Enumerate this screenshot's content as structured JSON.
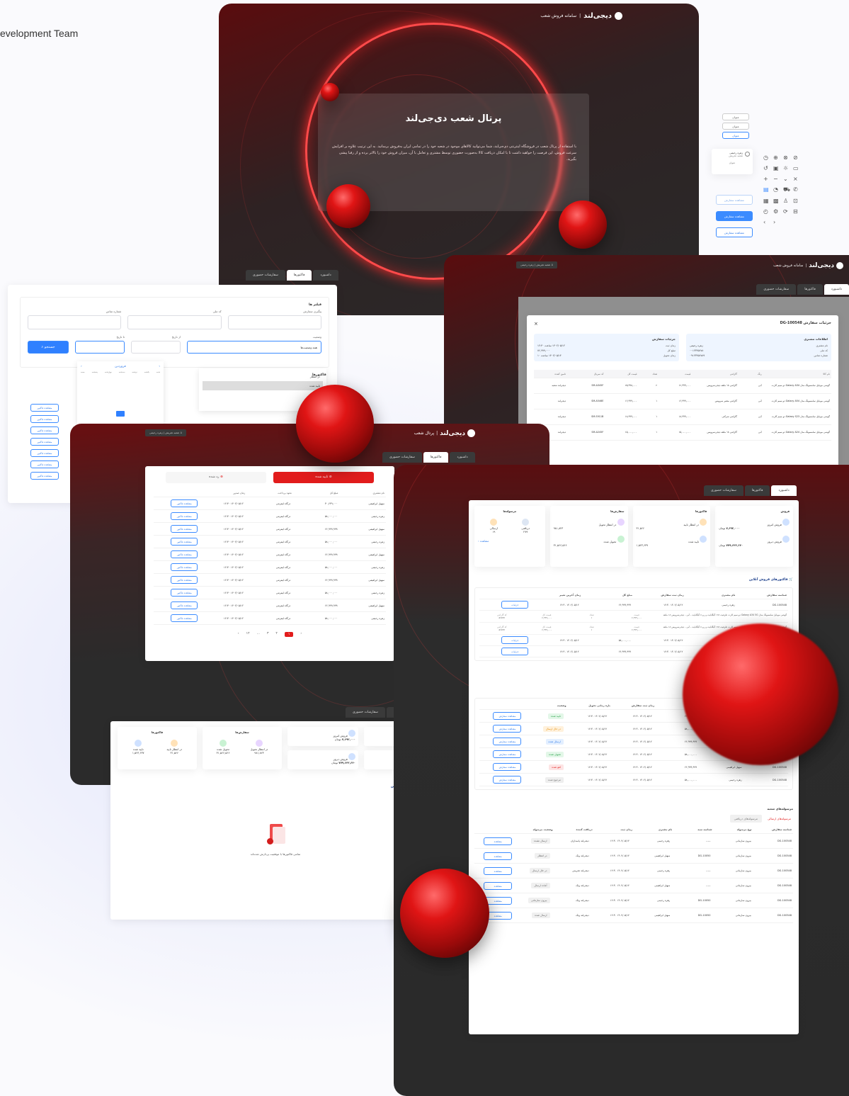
{
  "team_label": "evelopment Team",
  "brand": {
    "logo": "دیجی‌لند",
    "separator": "|",
    "app_name": "سامانه فروش شعب",
    "portal_short": "پرتال شعب"
  },
  "hero": {
    "title": "پرتال شعب دی‌جی‌لند",
    "body": "با استفاده از پرتال شعب در فروشگاه اینترنتی دی‌جی‌لند، شما می‌توانید کالاهای موجود در شعبه خود را در تمامی ایران به‌فروش برسانید. به این ترتیب علاوه بر افزایش سرعت فروش، این فرصت را خواهید داشت تا با امکان دریافت کالا به‌صورت حضوری توسط مشتری و تعامل با آن، میزان فروش خود را بالاتر برده و از رقبا پیشی بگیرید."
  },
  "tabs": {
    "dashboard": "داشبورد",
    "invoices": "فاکتورها",
    "in_person": "سفارشات حضوری"
  },
  "user_chip": "شعبه تجریش | زهره رحیمی",
  "side_panel": {
    "type_buttons": [
      "عنوان",
      "عنوان",
      "عنوان"
    ],
    "profile_name": "زهره رحیمی",
    "profile_sub": "شعبه تجریش",
    "profile_extra": "عنوان",
    "view_order": "مشاهده سفارش"
  },
  "filters": {
    "section": "فیلتر ها",
    "tracking": "پیگیری سفارش",
    "customer": "نام مشتری",
    "code": "کد ملی",
    "phone": "شماره تماس",
    "from": "از تاریخ",
    "to": "تا تاریخ",
    "status": "وضعیت",
    "status_value": "همه وضعیت‌ها",
    "search": "جستجو",
    "status_options": [
      "در انتظار",
      "تایید شده",
      "لغو شده"
    ],
    "calendar_month": "فروردین",
    "weekdays": [
      "شنبه",
      "یکشنبه",
      "دوشنبه",
      "سه‌شنبه",
      "چهارشنبه",
      "پنجشنبه",
      "جمعه"
    ],
    "invoices_label": "فاکتورها"
  },
  "order_modal": {
    "title": "جزئیات سفارش DG-100548",
    "close": "×",
    "customer_title": "اطلاعات مشتری",
    "customer_rows": [
      {
        "k": "نام مشتری",
        "v": "زهره رحیمی"
      },
      {
        "k": "کد ملی",
        "v": "۰۰۱۲۳۴۵۶۷۸"
      },
      {
        "k": "شماره تماس",
        "v": "۰۹۱۲۳۴۵۶۷۸۹"
      }
    ],
    "order_title": "جزئیات سفارش",
    "order_rows": [
      {
        "k": "زمان ثبت",
        "v": "۱۴۰۲/۰۵/۱۲ ساعت ۱۲:۳۰"
      },
      {
        "k": "مبلغ کل",
        "v": "۷۶,۹۹۹,۰۰۰"
      },
      {
        "k": "زمان تحویل",
        "v": "۱۴۰۲/۰۵/۱۴ ساعت ۱۰"
      }
    ],
    "columns": [
      "نام کالا",
      "رنگ",
      "گارانتی",
      "قیمت",
      "تعداد",
      "قیمت کل",
      "کد سریال",
      "تامین کننده"
    ],
    "items": [
      {
        "name": "گوشی موبایل سامسونگ مدل Galaxy A34 دو سیم کارت",
        "color": "آبی",
        "warranty": "گارانتی ۱۸ ماهه دیجی‌سرویس",
        "price": "۱۲,۹۹۹,۰۰۰",
        "qty": "۲",
        "total": "۲۵,۹۹۸,۰۰۰",
        "serial": "SM-A345F",
        "vendor": "دیجی‌لند شعبه"
      },
      {
        "name": "گوشی موبایل سامسونگ مدل Galaxy A54 دو سیم کارت",
        "color": "آبی",
        "warranty": "گارانتی معتبر سرویس",
        "price": "۱۶,۹۹۹,۰۰۰",
        "qty": "۱",
        "total": "۱۶,۹۹۹,۰۰۰",
        "serial": "SM-A546E",
        "vendor": "دیجی‌لند"
      },
      {
        "name": "گوشی موبایل سامسونگ مدل Galaxy S23 دو سیم کارت",
        "color": "آبی",
        "warranty": "گارانتی شرکتی",
        "price": "۱۸,۹۹۹,۰۰۰",
        "qty": "۱",
        "total": "۱۸,۹۹۹,۰۰۰",
        "serial": "SM-S911B",
        "vendor": "دیجی‌لند"
      },
      {
        "name": "گوشی موبایل سامسونگ مدل Galaxy A24 دو سیم کارت",
        "color": "آبی",
        "warranty": "گارانتی ۱۸ ماهه دیجی‌سرویس",
        "price": "۱۵,۰۰۰,۰۰۰",
        "qty": "۱",
        "total": "۱۵,۰۰۰,۰۰۰",
        "serial": "SM-A245F",
        "vendor": "دیجی‌لند"
      }
    ]
  },
  "invoice_list": {
    "tab_confirmed": "تایید شده",
    "tab_rejected": "رد شده",
    "columns": [
      "نام مشتری",
      "مبلغ کل",
      "نحوه پرداخت",
      "زمان صدور"
    ],
    "payment": "درگاه اینترنتی",
    "date": "۱۴۰۲/۰۵/۱۲ ۱۲:۳۰",
    "action": "مشاهده فاکتور",
    "rows": [
      {
        "customer": "سهیل ابراهیمی",
        "amount": "۳۰,۶۳۹,۰۰۰"
      },
      {
        "customer": "زهره رحیمی",
        "amount": "۵۸,۰۰۰,۰۰۰"
      },
      {
        "customer": "سهیل ابراهیمی",
        "amount": "۶۶,۹۹۹,۹۹۹"
      },
      {
        "customer": "زهره رحیمی",
        "amount": "۵۸,۰۰۰,۰۰۰"
      },
      {
        "customer": "سهیل ابراهیمی",
        "amount": "۶۶,۹۹۹,۹۹۹"
      },
      {
        "customer": "زهره رحیمی",
        "amount": "۵۸,۰۰۰,۰۰۰"
      },
      {
        "customer": "سهیل ابراهیمی",
        "amount": "۶۶,۹۹۹,۹۹۹"
      },
      {
        "customer": "زهره رحیمی",
        "amount": "۵۸,۰۰۰,۰۰۰"
      },
      {
        "customer": "سهیل ابراهیمی",
        "amount": "۶۶,۹۹۹,۹۹۹"
      },
      {
        "customer": "زهره رحیمی",
        "amount": "۵۸,۰۰۰,۰۰۰"
      }
    ],
    "pages": [
      "۱",
      "۲",
      "۳",
      "...",
      "۱۲"
    ]
  },
  "dashboard": {
    "sales_title": "فروش",
    "sales": [
      {
        "label": "فروش امروز",
        "value": "۷,۶۹۲,۰۰۰",
        "unit": "تومان"
      },
      {
        "label": "فروش دیروز",
        "value": "۷۷۹,۶۳۲,۶۴۰",
        "unit": "تومان"
      }
    ],
    "sales_week": [
      {
        "label": "فروش هفته جاری",
        "value": "۹,۶۵۵,۰۰۰",
        "unit": "تومان"
      },
      {
        "label": "فروش ماه جاری",
        "value": "۷۷۹,۶۳۲,۶۴۰",
        "unit": "تومان"
      }
    ],
    "invoices_title": "فاکتورها",
    "invoices": [
      {
        "label": "در انتظار تایید",
        "value": "۳۱,۵۶۶"
      },
      {
        "label": "تایید شده",
        "value": "۱,۵۲۳,۶۳۷"
      }
    ],
    "orders_title": "سفارش‌ها",
    "orders": [
      {
        "label": "در انتظار تحویل",
        "value": "۹۸۱,۸۲۳"
      },
      {
        "label": "تحویل شده",
        "value": "۳۱,۵۶۶,۵۶۶"
      }
    ],
    "packages_title": "مرسوله‌ها",
    "packages": [
      {
        "label": "دریافتی",
        "value": "۲۷۹"
      },
      {
        "label": "ارسالی",
        "value": "۱۹"
      }
    ],
    "more": "مشاهده",
    "online_title": "فاکتورهای فروش آنلاین",
    "empty_msg": "تمامی فاکتورها با موفقیت پردازش شده‌اند",
    "inv_cols": [
      "شناسه سفارش",
      "نام مشتری",
      "زمان ثبت سفارش",
      "مبلغ کل",
      "زمان آخرین تغییر"
    ],
    "inv_rows": [
      {
        "id": "DG-100548",
        "name": "زهره رحیمی",
        "date": "۱۴۰۲/۰۵/۱۲ ۱۲:۳۰",
        "amount": "۶۶,۹۹۹,۹۹۹"
      },
      {
        "id": "DG-100548",
        "name": "سهیل ابراهیمی",
        "date": "۱۴۰۲/۰۵/۱۲ ۱۲:۳۰",
        "amount": "۵۸,۰۰۰,۰۰۰"
      },
      {
        "id": "DG-100548",
        "name": "زهره رحیمی",
        "date": "۱۴۰۲/۰۵/۱۲ ۱۲:۳۰",
        "amount": "۶۶,۹۹۹,۹۹۹"
      }
    ],
    "detail_btn": "جزئیات",
    "item_desc": "گوشی موبایل سامسونگ مدل Galaxy A34 5G دو سیم کارت ظرفیت ۱۲۸ گیگابایت و رم ۸ گیگابایت - آبی - دیجی‌سرویس ۱۸ ماهه",
    "detail_keys": [
      "قیمت",
      "تعداد",
      "قیمت کل",
      "کد گارانتی"
    ],
    "detail_vals": [
      "۶,۹۹۹,۰۰۰",
      "۱",
      "۶,۹۹۹,۰۰۰",
      "۵۶۷۸۹"
    ],
    "order_cols": [
      "شناسه سفارش",
      "نام مشتری",
      "مبلغ کل",
      "زمان ثبت سفارش",
      "بازه زمانی تحویل",
      "وضعیت"
    ],
    "order_rows": [
      {
        "id": "DG-100548",
        "name": "سهیل ابراهیمی",
        "amount": "۶۶,۹۹۹,۹۹۹",
        "status": "تایید شده",
        "tone": "green"
      },
      {
        "id": "DG-100548",
        "name": "زهره رحیمی",
        "amount": "۵۸,۰۰۰,۰۰۰",
        "status": "در حال ارسال",
        "tone": "orange"
      },
      {
        "id": "DG-100548",
        "name": "سهیل ابراهیمی",
        "amount": "۶۶,۹۹۹,۹۹۹",
        "status": "ارسال شده",
        "tone": "blue"
      },
      {
        "id": "DG-100548",
        "name": "زهره رحیمی",
        "amount": "۵۸,۰۰۰,۰۰۰",
        "status": "تحویل شده",
        "tone": "green"
      },
      {
        "id": "DG-100548",
        "name": "سهیل ابراهیمی",
        "amount": "۶۶,۹۹۹,۹۹۹",
        "status": "لغو شده",
        "tone": "red"
      },
      {
        "id": "DG-100548",
        "name": "زهره رحیمی",
        "amount": "۵۸,۰۰۰,۰۰۰",
        "status": "مرجوع شده",
        "tone": "gray"
      }
    ],
    "view_order": "مشاهده سفارش",
    "shipments_title": "مرسوله‌های شعبه",
    "ship_tabs": [
      "مرسوله‌های ارسالی",
      "مرسوله‌های دریافتی"
    ],
    "ship_cols": [
      "شناسه سفارش",
      "نوع مرسوله",
      "شناسه سبد",
      "نام مشتری",
      "زمان ثبت",
      "دریافت کننده",
      "وضعیت مرسوله"
    ],
    "ship_rows": [
      {
        "id": "DG-100548",
        "type": "بیرون سازمانی",
        "cart": "-----",
        "name": "زهره رحیمی",
        "receiver": "دیجی‌لند پاسداران",
        "status": "ارسال نشده"
      },
      {
        "id": "DG-100548",
        "type": "بیرون سازمانی",
        "cart": "DG-10050",
        "name": "سهیل ابراهیمی",
        "receiver": "دیجی‌لند ونک",
        "status": "در انتظار"
      },
      {
        "id": "DG-100548",
        "type": "بیرون سازمانی",
        "cart": "-----",
        "name": "زهره رحیمی",
        "receiver": "دیجی‌لند تجریش",
        "status": "در حال ارسال"
      },
      {
        "id": "DG-100548",
        "type": "بیرون سازمانی",
        "cart": "-----",
        "name": "سهیل ابراهیمی",
        "receiver": "دیجی‌لند ونک",
        "status": "آماده ارسال"
      },
      {
        "id": "DG-100548",
        "type": "بیرون سازمانی",
        "cart": "DG-10050",
        "name": "زهره رحیمی",
        "receiver": "دیجی‌لند ونک",
        "status": "بیرون سازمانی"
      },
      {
        "id": "DG-100548",
        "type": "بیرون سازمانی",
        "cart": "DG-10050",
        "name": "سهیل ابراهیمی",
        "receiver": "دیجی‌لند ونک",
        "status": "ارسال شده"
      }
    ],
    "ship_btn": "مشاهده"
  }
}
